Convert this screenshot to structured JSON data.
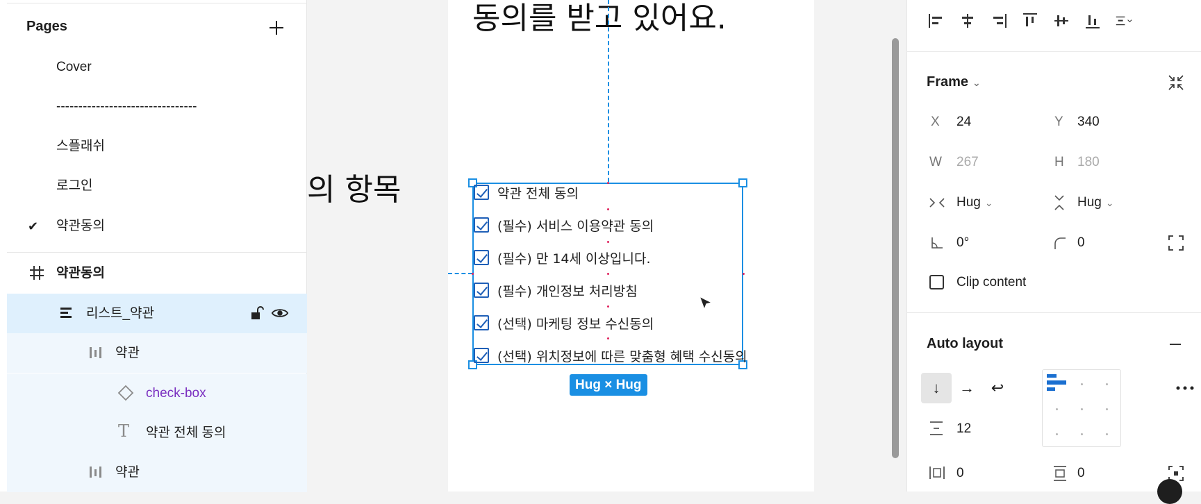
{
  "pages_panel": {
    "title": "Pages",
    "items": [
      {
        "label": "Cover",
        "current": false
      },
      {
        "label": "--------------------------------",
        "current": false
      },
      {
        "label": "스플래쉬",
        "current": false
      },
      {
        "label": "로그인",
        "current": false
      },
      {
        "label": "약관동의",
        "current": true
      }
    ]
  },
  "layers": {
    "frame": "약관동의",
    "list": "리스트_약관",
    "group1": "약관",
    "component": "check-box",
    "text_layer": "약관 전체 동의",
    "group2": "약관"
  },
  "canvas": {
    "heading_top": "동의를 받고 있어요.",
    "heading_mid": "의 항목",
    "checkbox_items": [
      "약관 전체 동의",
      "(필수) 서비스 이용약관 동의",
      "(필수) 만 14세 이상입니다.",
      "(필수) 개인정보 처리방침",
      "(선택) 마케팅 정보 수신동의",
      "(선택) 위치정보에 따른 맞춤형 혜택 수신동의"
    ],
    "size_badge": "Hug × Hug"
  },
  "inspector": {
    "frame_title": "Frame",
    "x_label": "X",
    "x_value": "24",
    "y_label": "Y",
    "y_value": "340",
    "w_label": "W",
    "w_value": "267",
    "h_label": "H",
    "h_value": "180",
    "width_mode": "Hug",
    "height_mode": "Hug",
    "rotation": "0°",
    "radius": "0",
    "clip_label": "Clip content",
    "auto_layout_title": "Auto layout",
    "gap": "12",
    "padding_h": "0",
    "padding_v": "0"
  },
  "colors": {
    "accent": "#1a8fe3",
    "selection_bg": "#dff0fd",
    "component": "#7a2fc0"
  }
}
